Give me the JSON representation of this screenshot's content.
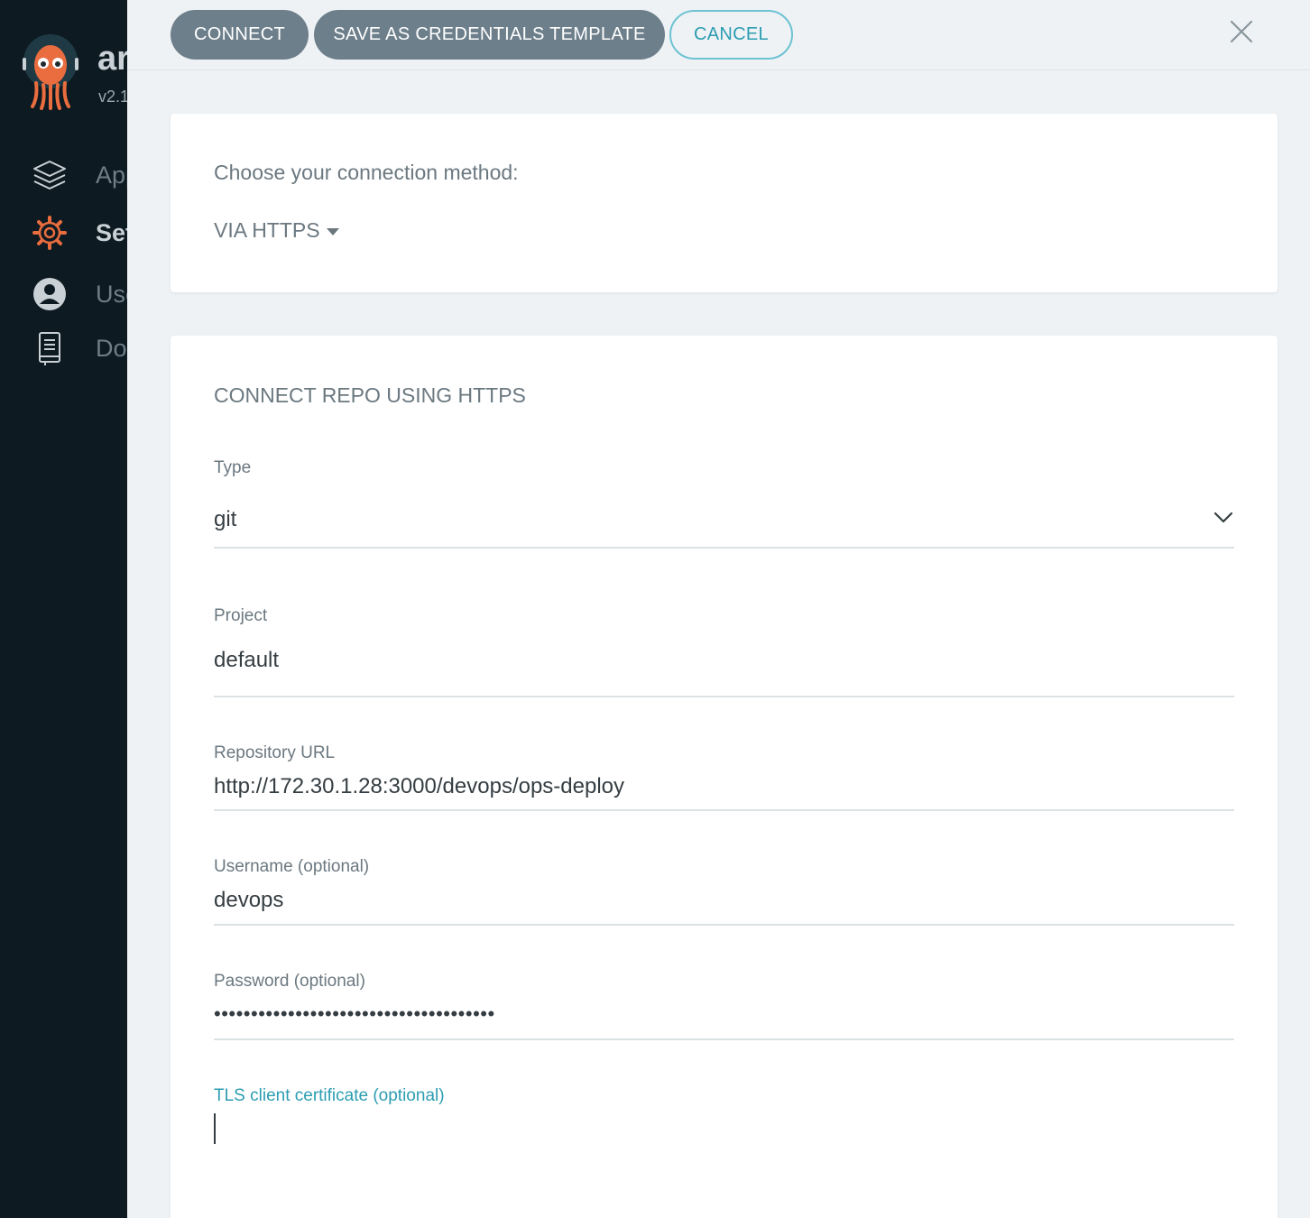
{
  "sidebar": {
    "brand_text": "ar",
    "version": "v2.1",
    "items": [
      {
        "label": "Applications",
        "icon": "layers-icon",
        "active": false
      },
      {
        "label": "Settings",
        "icon": "gear-icon",
        "active": true
      },
      {
        "label": "User Info",
        "icon": "user-icon",
        "active": false
      },
      {
        "label": "Documentation",
        "icon": "docs-icon",
        "active": false
      }
    ]
  },
  "header": {
    "connect_label": "CONNECT",
    "save_template_label": "SAVE AS CREDENTIALS TEMPLATE",
    "cancel_label": "CANCEL"
  },
  "connection_method": {
    "prompt": "Choose your connection method:",
    "selected": "VIA HTTPS"
  },
  "form": {
    "title": "CONNECT REPO USING HTTPS",
    "type": {
      "label": "Type",
      "value": "git"
    },
    "project": {
      "label": "Project",
      "value": "default"
    },
    "repo_url": {
      "label": "Repository URL",
      "value": "http://172.30.1.28:3000/devops/ops-deploy"
    },
    "username": {
      "label": "Username (optional)",
      "value": "devops"
    },
    "password": {
      "label": "Password (optional)",
      "value": "••••••••••••••••••••••••••••••••••••••"
    },
    "tls_cert": {
      "label": "TLS client certificate (optional)",
      "value": ""
    }
  },
  "colors": {
    "sidebar_bg": "#0e1a21",
    "primary_button": "#6d7f8b",
    "accent": "#2c9db1",
    "logo_orange": "#e96d3f"
  }
}
